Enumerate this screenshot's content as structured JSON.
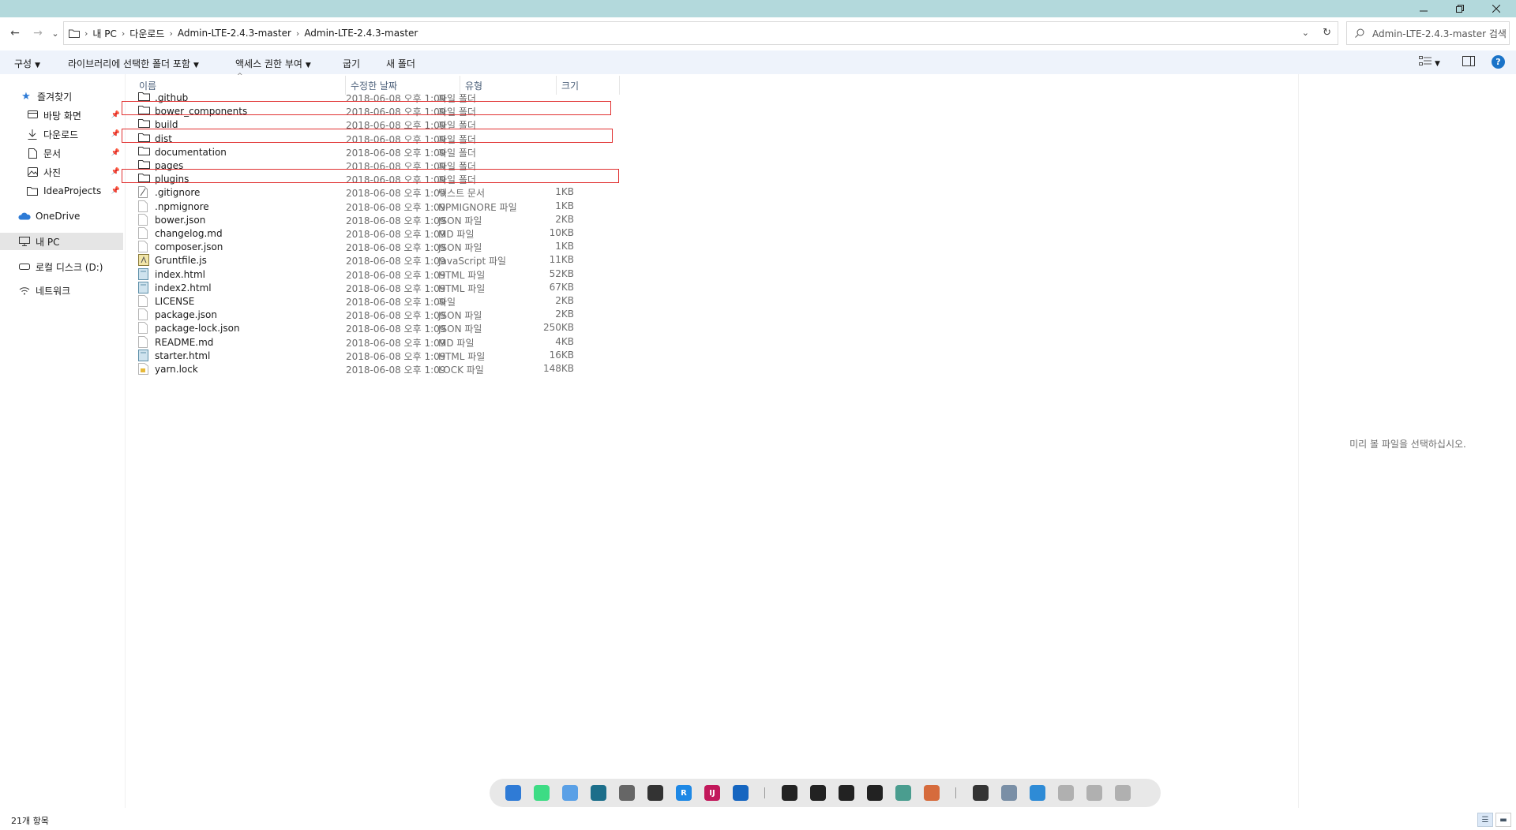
{
  "window": {
    "minimize_icon": "minimize-icon",
    "restore_icon": "restore-icon",
    "close_icon": "close-icon"
  },
  "nav": {
    "back": "←",
    "forward": "→",
    "recent": "⌄",
    "up": "↑"
  },
  "address": {
    "breadcrumbs": [
      "내 PC",
      "다운로드",
      "Admin-LTE-2.4.3-master",
      "Admin-LTE-2.4.3-master"
    ],
    "refresh_icon": "refresh-icon",
    "dropdown_icon": "chevron-down-icon"
  },
  "search": {
    "placeholder": "Admin-LTE-2.4.3-master 검색"
  },
  "commands": {
    "organize": "구성",
    "include_library": "라이브러리에 선택한 폴더 포함",
    "share_access": "액세스 권한 부여",
    "burn": "굽기",
    "new_folder": "새 폴더"
  },
  "sidebar": {
    "favorites": "즐겨찾기",
    "items": [
      {
        "label": "바탕 화면",
        "icon": "desktop-icon",
        "pinned": true
      },
      {
        "label": "다운로드",
        "icon": "download-icon",
        "pinned": true
      },
      {
        "label": "문서",
        "icon": "document-icon",
        "pinned": true
      },
      {
        "label": "사진",
        "icon": "pictures-icon",
        "pinned": true
      },
      {
        "label": "IdeaProjects",
        "icon": "folder-icon",
        "pinned": true
      }
    ],
    "onedrive": "OneDrive",
    "this_pc": "내 PC",
    "local_disk": "로컬 디스크 (D:)",
    "network": "네트워크"
  },
  "columns": {
    "name": "이름",
    "modified": "수정한 날짜",
    "type": "유형",
    "size": "크기"
  },
  "files": [
    {
      "name": ".github",
      "date": "2018-06-08 오후 1:09",
      "type": "파일 폴더",
      "size": "",
      "icon": "folder",
      "highlighted": false
    },
    {
      "name": "bower_components",
      "date": "2018-06-08 오후 1:09",
      "type": "파일 폴더",
      "size": "",
      "icon": "folder",
      "highlighted": true
    },
    {
      "name": "build",
      "date": "2018-06-08 오후 1:09",
      "type": "파일 폴더",
      "size": "",
      "icon": "folder",
      "highlighted": false
    },
    {
      "name": "dist",
      "date": "2018-06-08 오후 1:09",
      "type": "파일 폴더",
      "size": "",
      "icon": "folder",
      "highlighted": true
    },
    {
      "name": "documentation",
      "date": "2018-06-08 오후 1:09",
      "type": "파일 폴더",
      "size": "",
      "icon": "folder",
      "highlighted": false
    },
    {
      "name": "pages",
      "date": "2018-06-08 오후 1:09",
      "type": "파일 폴더",
      "size": "",
      "icon": "folder",
      "highlighted": false
    },
    {
      "name": "plugins",
      "date": "2018-06-08 오후 1:09",
      "type": "파일 폴더",
      "size": "",
      "icon": "folder",
      "highlighted": true
    },
    {
      "name": ".gitignore",
      "date": "2018-06-08 오후 1:09",
      "type": "텍스트 문서",
      "size": "1KB",
      "icon": "text",
      "highlighted": false
    },
    {
      "name": ".npmignore",
      "date": "2018-06-08 오후 1:09",
      "type": "NPMIGNORE 파일",
      "size": "1KB",
      "icon": "blank",
      "highlighted": false
    },
    {
      "name": "bower.json",
      "date": "2018-06-08 오후 1:09",
      "type": "JSON 파일",
      "size": "2KB",
      "icon": "blank",
      "highlighted": false
    },
    {
      "name": "changelog.md",
      "date": "2018-06-08 오후 1:09",
      "type": "MD 파일",
      "size": "10KB",
      "icon": "blank",
      "highlighted": false
    },
    {
      "name": "composer.json",
      "date": "2018-06-08 오후 1:09",
      "type": "JSON 파일",
      "size": "1KB",
      "icon": "blank",
      "highlighted": false
    },
    {
      "name": "Gruntfile.js",
      "date": "2018-06-08 오후 1:09",
      "type": "JavaScript 파일",
      "size": "11KB",
      "icon": "script",
      "highlighted": false
    },
    {
      "name": "index.html",
      "date": "2018-06-08 오후 1:09",
      "type": "HTML 파일",
      "size": "52KB",
      "icon": "html",
      "highlighted": false
    },
    {
      "name": "index2.html",
      "date": "2018-06-08 오후 1:09",
      "type": "HTML 파일",
      "size": "67KB",
      "icon": "html",
      "highlighted": false
    },
    {
      "name": "LICENSE",
      "date": "2018-06-08 오후 1:09",
      "type": "파일",
      "size": "2KB",
      "icon": "blank",
      "highlighted": false
    },
    {
      "name": "package.json",
      "date": "2018-06-08 오후 1:09",
      "type": "JSON 파일",
      "size": "2KB",
      "icon": "blank",
      "highlighted": false
    },
    {
      "name": "package-lock.json",
      "date": "2018-06-08 오후 1:09",
      "type": "JSON 파일",
      "size": "250KB",
      "icon": "blank",
      "highlighted": false
    },
    {
      "name": "README.md",
      "date": "2018-06-08 오후 1:09",
      "type": "MD 파일",
      "size": "4KB",
      "icon": "blank",
      "highlighted": false
    },
    {
      "name": "starter.html",
      "date": "2018-06-08 오후 1:09",
      "type": "HTML 파일",
      "size": "16KB",
      "icon": "html",
      "highlighted": false
    },
    {
      "name": "yarn.lock",
      "date": "2018-06-08 오후 1:09",
      "type": "LOCK 파일",
      "size": "148KB",
      "icon": "lock",
      "highlighted": false
    }
  ],
  "preview": {
    "message": "미리 볼 파일을 선택하십시오."
  },
  "status": {
    "count": "21개 항목"
  },
  "colors": {
    "titlebar": "#b3d9dc",
    "command_bar": "#eef3fb",
    "highlight_border": "#e03030",
    "folder": "#f5c542",
    "accent": "#1a73c8"
  },
  "dock": {
    "icons": [
      {
        "name": "file-explorer-icon",
        "color": "#2f7bd6",
        "glyph": ""
      },
      {
        "name": "android-icon",
        "color": "#3ddc84",
        "glyph": ""
      },
      {
        "name": "app-grid-icon",
        "color": "#5aa0e6",
        "glyph": ""
      },
      {
        "name": "shark-icon",
        "color": "#1c6e8a",
        "glyph": ""
      },
      {
        "name": "settings-icon",
        "color": "#666666",
        "glyph": ""
      },
      {
        "name": "audio-icon",
        "color": "#333333",
        "glyph": ""
      },
      {
        "name": "r-app-icon",
        "color": "#1e88e5",
        "glyph": "R"
      },
      {
        "name": "intellij-icon",
        "color": "#c2185b",
        "glyph": "IJ"
      },
      {
        "name": "media-player-icon",
        "color": "#1565c0",
        "glyph": ""
      },
      {
        "name": "terminal-icon",
        "color": "#222222",
        "glyph": ""
      },
      {
        "name": "terminal-icon",
        "color": "#222222",
        "glyph": ""
      },
      {
        "name": "terminal-icon",
        "color": "#222222",
        "glyph": ""
      },
      {
        "name": "terminal-icon",
        "color": "#222222",
        "glyph": ""
      },
      {
        "name": "slack-icon",
        "color": "#4a9d8f",
        "glyph": ""
      },
      {
        "name": "network-graph-icon",
        "color": "#d66b3c",
        "glyph": ""
      },
      {
        "name": "recorder-icon",
        "color": "#333333",
        "glyph": ""
      },
      {
        "name": "notepad-icon",
        "color": "#7a8fa6",
        "glyph": ""
      },
      {
        "name": "bluetooth-icon",
        "color": "#2e8bd6",
        "glyph": ""
      },
      {
        "name": "keyboard-icon",
        "color": "#b0b0b0",
        "glyph": ""
      },
      {
        "name": "display-icon",
        "color": "#b0b0b0",
        "glyph": ""
      },
      {
        "name": "volume-icon",
        "color": "#b0b0b0",
        "glyph": ""
      }
    ]
  }
}
